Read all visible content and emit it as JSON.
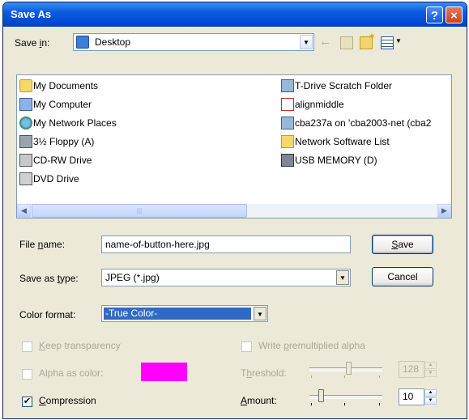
{
  "window": {
    "title": "Save As",
    "help_glyph": "?",
    "close_glyph": "×"
  },
  "save_in": {
    "label_pre": "Save ",
    "label_key": "i",
    "label_post": "n:",
    "value": "Desktop"
  },
  "files_left": [
    "My Documents",
    "My Computer",
    "My Network Places",
    "3½ Floppy (A)",
    "CD-RW Drive",
    "DVD Drive"
  ],
  "files_right": [
    "T-Drive  Scratch Folder",
    "alignmiddle",
    "cba237a on 'cba2003-net (cba2",
    "Network Software List",
    "USB MEMORY (D)"
  ],
  "filename": {
    "label_pre": "File ",
    "label_key": "n",
    "label_post": "ame:",
    "value": "name-of-button-here.jpg"
  },
  "savetype": {
    "label_pre": "Save as ",
    "label_key": "t",
    "label_post": "ype:",
    "value": "JPEG (*.jpg)"
  },
  "buttons": {
    "save_key": "S",
    "save_rest": "ave",
    "cancel": "Cancel"
  },
  "color_format": {
    "label": "Color format:",
    "value": "-True Color-"
  },
  "keep_transparency": {
    "key": "K",
    "rest": "eep transparency",
    "checked": false
  },
  "premultiplied": {
    "pre": "Write ",
    "key": "p",
    "rest": "remultiplied alpha",
    "checked": false
  },
  "alpha_color": {
    "label": "Alpha as color:",
    "swatch": "#ff00ff",
    "checked": false
  },
  "threshold": {
    "label_pre": "T",
    "label_key": "h",
    "label_post": "reshold:",
    "value": "128"
  },
  "compression": {
    "key": "C",
    "rest": "ompression",
    "checked": true
  },
  "amount": {
    "key": "A",
    "rest": "mount:",
    "value": "10"
  }
}
